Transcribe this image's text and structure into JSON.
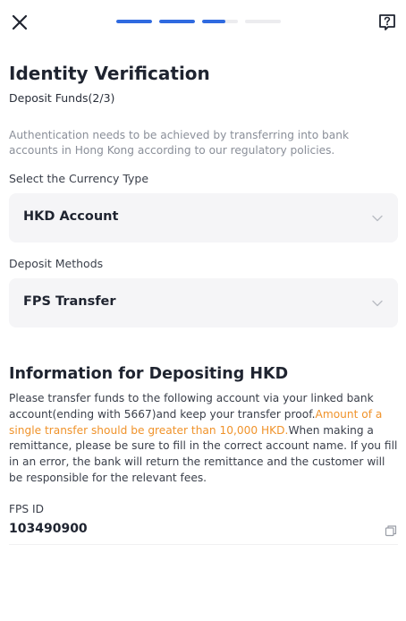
{
  "header": {
    "close_icon": "close-icon",
    "help_icon": "question-bubble-icon",
    "progress": {
      "steps": [
        {
          "fill": 1.0
        },
        {
          "fill": 1.0
        },
        {
          "fill": 0.65
        },
        {
          "fill": 0.0
        }
      ],
      "active_color": "#2f6ae0",
      "inactive_color": "#ececef"
    }
  },
  "page": {
    "title": "Identity Verification",
    "subtitle": "Deposit Funds(2/3)",
    "notice": "Authentication needs to be achieved by transferring into bank accounts in Hong Kong according to our regulatory policies."
  },
  "currency": {
    "label": "Select the Currency Type",
    "value": "HKD Account"
  },
  "method": {
    "label": "Deposit Methods",
    "value": "FPS Transfer"
  },
  "info": {
    "title": "Information for Depositing HKD",
    "text_before": "Please transfer funds to the following account via your linked bank account(ending with 5667)and keep your transfer proof.",
    "warning": "Amount of a single transfer should be greater than 10,000 HKD.",
    "text_after": "When making a remittance, please be sure to fill in the correct account name. If you fill in an error, the bank will return the remittance and the customer will be responsible for the relevant fees.",
    "warning_color": "#f0932b"
  },
  "fps": {
    "label": "FPS ID",
    "value": "103490900",
    "copy_icon": "copy-icon"
  }
}
